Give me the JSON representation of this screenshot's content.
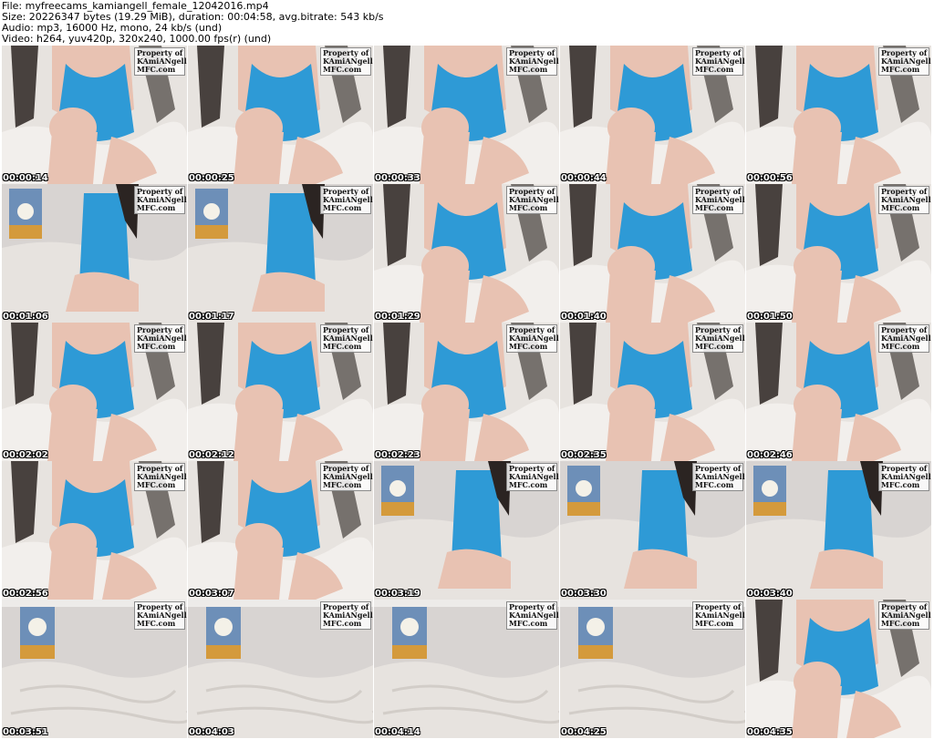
{
  "header": {
    "file": "File: myfreecams_kamiangell_female_12042016.mp4",
    "size": "Size: 20226347 bytes (19.29 MiB), duration: 00:04:58, avg.bitrate: 543 kb/s",
    "audio": "Audio: mp3, 16000 Hz, mono, 24 kb/s (und)",
    "video": "Video: h264, yuv420p, 320x240, 1000.00 fps(r) (und)"
  },
  "watermark": {
    "line1": "Property of",
    "line2": "KAmiANgell",
    "line3": "MFC.com"
  },
  "colors": {
    "top_blue": "#2e9ad6",
    "skin": "#e8c2b2",
    "blanket": "#e7e3df",
    "wall": "#d8d4d2",
    "hair": "#2b2422"
  },
  "thumbnails": [
    {
      "timestamp": "00:00:14",
      "scene": "closeup"
    },
    {
      "timestamp": "00:00:25",
      "scene": "closeup"
    },
    {
      "timestamp": "00:00:33",
      "scene": "closeup"
    },
    {
      "timestamp": "00:00:44",
      "scene": "closeup"
    },
    {
      "timestamp": "00:00:56",
      "scene": "closeup"
    },
    {
      "timestamp": "00:01:06",
      "scene": "room-person"
    },
    {
      "timestamp": "00:01:17",
      "scene": "room-person"
    },
    {
      "timestamp": "00:01:29",
      "scene": "closeup"
    },
    {
      "timestamp": "00:01:40",
      "scene": "closeup"
    },
    {
      "timestamp": "00:01:50",
      "scene": "closeup"
    },
    {
      "timestamp": "00:02:02",
      "scene": "closeup"
    },
    {
      "timestamp": "00:02:12",
      "scene": "closeup"
    },
    {
      "timestamp": "00:02:23",
      "scene": "closeup"
    },
    {
      "timestamp": "00:02:35",
      "scene": "closeup"
    },
    {
      "timestamp": "00:02:46",
      "scene": "closeup"
    },
    {
      "timestamp": "00:02:56",
      "scene": "closeup"
    },
    {
      "timestamp": "00:03:07",
      "scene": "closeup"
    },
    {
      "timestamp": "00:03:19",
      "scene": "room-person"
    },
    {
      "timestamp": "00:03:30",
      "scene": "room-person"
    },
    {
      "timestamp": "00:03:40",
      "scene": "room-person"
    },
    {
      "timestamp": "00:03:51",
      "scene": "empty"
    },
    {
      "timestamp": "00:04:03",
      "scene": "empty"
    },
    {
      "timestamp": "00:04:14",
      "scene": "empty"
    },
    {
      "timestamp": "00:04:25",
      "scene": "empty"
    },
    {
      "timestamp": "00:04:35",
      "scene": "closeup"
    }
  ]
}
